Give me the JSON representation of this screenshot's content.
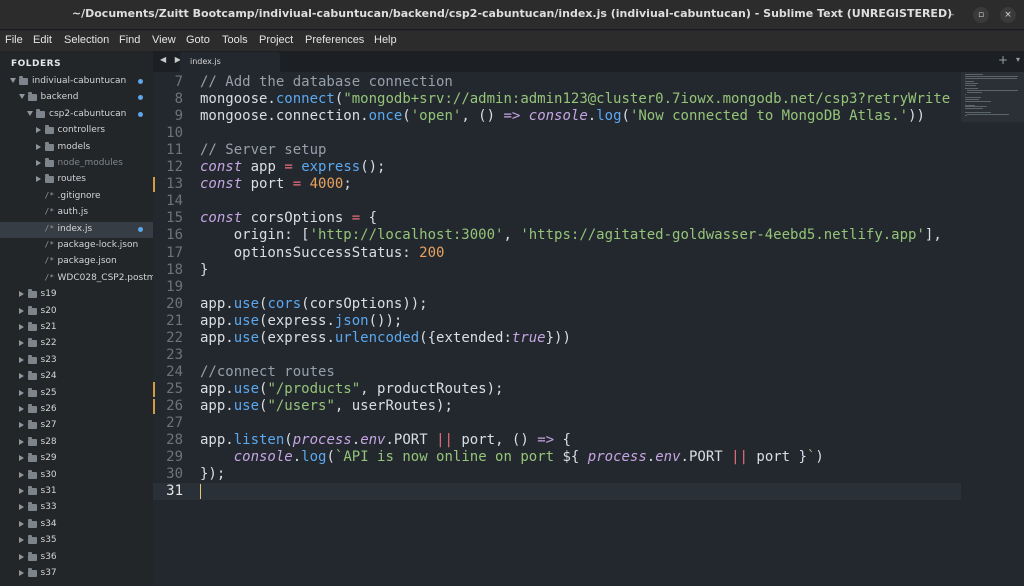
{
  "window": {
    "title": "~/Documents/Zuitt Bootcamp/indiviual-cabuntucan/backend/csp2-cabuntucan/index.js (indiviual-cabuntucan) - Sublime Text (UNREGISTERED)",
    "controls": {
      "minimize": "–",
      "maximize": "▫",
      "close": "×"
    }
  },
  "menu": [
    "File",
    "Edit",
    "Selection",
    "Find",
    "View",
    "Goto",
    "Tools",
    "Project",
    "Preferences",
    "Help"
  ],
  "sidebar": {
    "header": "FOLDERS",
    "items": [
      {
        "label": "indiviual-cabuntucan",
        "kind": "folder",
        "open": true,
        "dot": true
      },
      {
        "label": "backend",
        "kind": "folder",
        "open": true,
        "dot": true
      },
      {
        "label": "csp2-cabuntucan",
        "kind": "folder",
        "open": true,
        "dot": true
      },
      {
        "label": "controllers",
        "kind": "folder",
        "open": false
      },
      {
        "label": "models",
        "kind": "folder",
        "open": false
      },
      {
        "label": "node_modules",
        "kind": "folder",
        "open": false,
        "dim": true
      },
      {
        "label": "routes",
        "kind": "folder",
        "open": false
      },
      {
        "label": ".gitignore",
        "kind": "file"
      },
      {
        "label": "auth.js",
        "kind": "file"
      },
      {
        "label": "index.js",
        "kind": "file",
        "selected": true,
        "dot": true
      },
      {
        "label": "package-lock.json",
        "kind": "file"
      },
      {
        "label": "package.json",
        "kind": "file"
      },
      {
        "label": "WDC028_CSP2.postm",
        "kind": "file"
      },
      {
        "label": "s19",
        "kind": "folder",
        "open": false
      },
      {
        "label": "s20",
        "kind": "folder",
        "open": false
      },
      {
        "label": "s21",
        "kind": "folder",
        "open": false
      },
      {
        "label": "s22",
        "kind": "folder",
        "open": false
      },
      {
        "label": "s23",
        "kind": "folder",
        "open": false
      },
      {
        "label": "s24",
        "kind": "folder",
        "open": false
      },
      {
        "label": "s25",
        "kind": "folder",
        "open": false
      },
      {
        "label": "s26",
        "kind": "folder",
        "open": false
      },
      {
        "label": "s27",
        "kind": "folder",
        "open": false
      },
      {
        "label": "s28",
        "kind": "folder",
        "open": false
      },
      {
        "label": "s29",
        "kind": "folder",
        "open": false
      },
      {
        "label": "s30",
        "kind": "folder",
        "open": false
      },
      {
        "label": "s31",
        "kind": "folder",
        "open": false
      },
      {
        "label": "s33",
        "kind": "folder",
        "open": false
      },
      {
        "label": "s34",
        "kind": "folder",
        "open": false
      },
      {
        "label": "s35",
        "kind": "folder",
        "open": false
      },
      {
        "label": "s36",
        "kind": "folder",
        "open": false
      },
      {
        "label": "s37",
        "kind": "folder",
        "open": false
      }
    ]
  },
  "tabs": {
    "nav": "◀ ▶",
    "active": "index.js",
    "plus": "+",
    "menu": "▾"
  },
  "editor": {
    "current_line": 31,
    "lines": [
      {
        "n": 7,
        "tokens": [
          [
            "// Add the database connection",
            "comment"
          ]
        ]
      },
      {
        "n": 8,
        "tokens": [
          [
            "mongoose.",
            ""
          ],
          [
            "connect",
            "fn"
          ],
          [
            "(",
            ""
          ],
          [
            "\"mongodb+srv://admin:admin123@cluster0.7iowx.mongodb.net/csp3?retryWrite",
            "str"
          ]
        ]
      },
      {
        "n": 9,
        "tokens": [
          [
            "mongoose.connection.",
            ""
          ],
          [
            "once",
            "fn"
          ],
          [
            "(",
            ""
          ],
          [
            "'open'",
            "str"
          ],
          [
            ", () ",
            ""
          ],
          [
            "=>",
            "kw"
          ],
          [
            " ",
            ""
          ],
          [
            "console",
            "itl"
          ],
          [
            ".",
            ""
          ],
          [
            "log",
            "fn"
          ],
          [
            "(",
            ""
          ],
          [
            "'Now connected to MongoDB Atlas.'",
            "str"
          ],
          [
            "))",
            ""
          ]
        ]
      },
      {
        "n": 10,
        "tokens": []
      },
      {
        "n": 11,
        "tokens": [
          [
            "// Server setup",
            "comment"
          ]
        ]
      },
      {
        "n": 12,
        "tokens": [
          [
            "const",
            "kw"
          ],
          [
            " app ",
            ""
          ],
          [
            "=",
            "op"
          ],
          [
            " ",
            ""
          ],
          [
            "express",
            "fn"
          ],
          [
            "();",
            ""
          ]
        ]
      },
      {
        "n": 13,
        "modified": true,
        "tokens": [
          [
            "const",
            "kw"
          ],
          [
            " port ",
            ""
          ],
          [
            "=",
            "op"
          ],
          [
            " ",
            ""
          ],
          [
            "4000",
            "num"
          ],
          [
            ";",
            ""
          ]
        ]
      },
      {
        "n": 14,
        "tokens": []
      },
      {
        "n": 15,
        "tokens": [
          [
            "const",
            "kw"
          ],
          [
            " corsOptions ",
            ""
          ],
          [
            "=",
            "op"
          ],
          [
            " {",
            ""
          ]
        ]
      },
      {
        "n": 16,
        "tokens": [
          [
            "    origin: [",
            ""
          ],
          [
            "'http://localhost:3000'",
            "str"
          ],
          [
            ", ",
            ""
          ],
          [
            "'https://agitated-goldwasser-4eebd5.netlify.app'",
            "str"
          ],
          [
            "],",
            ""
          ]
        ]
      },
      {
        "n": 17,
        "tokens": [
          [
            "    optionsSuccessStatus: ",
            ""
          ],
          [
            "200",
            "num"
          ]
        ]
      },
      {
        "n": 18,
        "tokens": [
          [
            "}",
            ""
          ]
        ]
      },
      {
        "n": 19,
        "tokens": []
      },
      {
        "n": 20,
        "tokens": [
          [
            "app.",
            ""
          ],
          [
            "use",
            "fn"
          ],
          [
            "(",
            ""
          ],
          [
            "cors",
            "fn"
          ],
          [
            "(corsOptions));",
            ""
          ]
        ]
      },
      {
        "n": 21,
        "tokens": [
          [
            "app.",
            ""
          ],
          [
            "use",
            "fn"
          ],
          [
            "(express.",
            ""
          ],
          [
            "json",
            "fn"
          ],
          [
            "());",
            ""
          ]
        ]
      },
      {
        "n": 22,
        "tokens": [
          [
            "app.",
            ""
          ],
          [
            "use",
            "fn"
          ],
          [
            "(express.",
            ""
          ],
          [
            "urlencoded",
            "fn"
          ],
          [
            "({extended:",
            ""
          ],
          [
            "true",
            "itl"
          ],
          [
            "}))",
            ""
          ]
        ]
      },
      {
        "n": 23,
        "tokens": []
      },
      {
        "n": 24,
        "tokens": [
          [
            "//connect routes",
            "comment"
          ]
        ]
      },
      {
        "n": 25,
        "modified": true,
        "tokens": [
          [
            "app.",
            ""
          ],
          [
            "use",
            "fn"
          ],
          [
            "(",
            ""
          ],
          [
            "\"/products\"",
            "str"
          ],
          [
            ", productRoutes);",
            ""
          ]
        ]
      },
      {
        "n": 26,
        "modified": true,
        "tokens": [
          [
            "app.",
            ""
          ],
          [
            "use",
            "fn"
          ],
          [
            "(",
            ""
          ],
          [
            "\"/users\"",
            "str"
          ],
          [
            ", userRoutes);",
            ""
          ]
        ]
      },
      {
        "n": 27,
        "tokens": []
      },
      {
        "n": 28,
        "tokens": [
          [
            "app.",
            ""
          ],
          [
            "listen",
            "fn"
          ],
          [
            "(",
            ""
          ],
          [
            "process",
            "itl"
          ],
          [
            ".",
            ""
          ],
          [
            "env",
            "itl"
          ],
          [
            ".PORT ",
            ""
          ],
          [
            "||",
            "op"
          ],
          [
            " port, () ",
            ""
          ],
          [
            "=>",
            "kw"
          ],
          [
            " {",
            ""
          ]
        ]
      },
      {
        "n": 29,
        "tokens": [
          [
            "    ",
            ""
          ],
          [
            "console",
            "itl"
          ],
          [
            ".",
            ""
          ],
          [
            "log",
            "fn"
          ],
          [
            "(",
            ""
          ],
          [
            "`API is now online on port ",
            "str"
          ],
          [
            "${ ",
            ""
          ],
          [
            "process",
            "itl"
          ],
          [
            ".",
            ""
          ],
          [
            "env",
            "itl"
          ],
          [
            ".PORT ",
            ""
          ],
          [
            "||",
            "op"
          ],
          [
            " port }",
            ""
          ],
          [
            "`",
            "str"
          ],
          [
            ")",
            ""
          ]
        ]
      },
      {
        "n": 30,
        "tokens": [
          [
            "});",
            ""
          ]
        ]
      },
      {
        "n": 31,
        "tokens": []
      }
    ]
  }
}
